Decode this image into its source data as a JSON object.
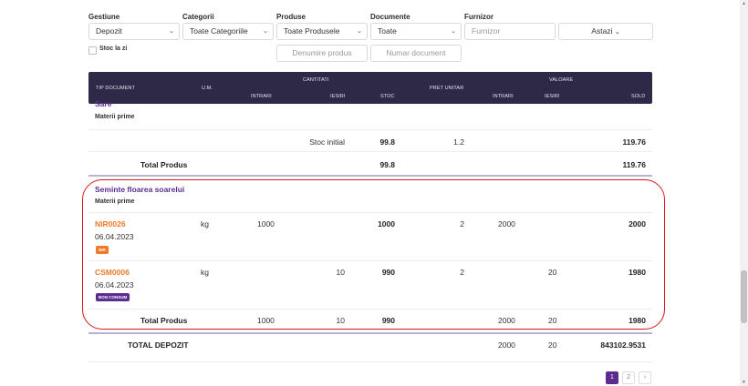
{
  "filters": {
    "gestiune": {
      "label": "Gestiune",
      "value": "Depozit"
    },
    "categorii": {
      "label": "Categorii",
      "value": "Toate Categoriile"
    },
    "produse": {
      "label": "Produse",
      "value": "Toate Produsele",
      "placeholder": "Denumire produs"
    },
    "documente": {
      "label": "Documente",
      "value": "Toate",
      "placeholder": "Numar document"
    },
    "furnizor": {
      "label": "Furnizor",
      "placeholder": "Furnizor"
    },
    "date_button": "Astazi",
    "stoc_la_zi": "Stoc la zi"
  },
  "table_header": {
    "tip_document": "TIP DOCUMENT",
    "um": "U.M.",
    "cantitati": "CANTITATI",
    "intrari": "INTRARI",
    "iesiri": "IESIRI",
    "stoc": "STOC",
    "pret_unitar": "PRET UNITAR",
    "valoare": "VALOARE",
    "v_intrari": "INTRARI",
    "v_iesiri": "IESIRI",
    "sold": "SOLD"
  },
  "product1": {
    "name": "Sare",
    "category": "Materii prime",
    "stoc_initial_label": "Stoc initial",
    "stoc_initial": "99.8",
    "pret": "1.2",
    "sold": "119.76",
    "total_label": "Total Produs",
    "total_stoc": "99.8",
    "total_sold": "119.76"
  },
  "product2": {
    "name": "Seminte floarea soarelui",
    "category": "Materii prime",
    "rows": [
      {
        "doc": "NIR0026",
        "date": "06.04.2023",
        "badge": "NIR",
        "badge_color": "#f0782a",
        "um": "kg",
        "intrari": "1000",
        "iesiri": "",
        "stoc": "1000",
        "pret": "2",
        "v_intrari": "2000",
        "v_iesiri": "",
        "sold": "2000"
      },
      {
        "doc": "CSM0006",
        "date": "06.04.2023",
        "badge": "BON CONSUM",
        "badge_color": "#5b2d91",
        "um": "kg",
        "intrari": "",
        "iesiri": "10",
        "stoc": "990",
        "pret": "2",
        "v_intrari": "",
        "v_iesiri": "20",
        "sold": "1980"
      }
    ],
    "total_label": "Total Produs",
    "total_intrari": "1000",
    "total_iesiri": "10",
    "total_stoc": "990",
    "total_v_intrari": "2000",
    "total_v_iesiri": "20",
    "total_sold": "1980"
  },
  "total_depozit": {
    "label": "TOTAL DEPOZIT",
    "v_intrari": "2000",
    "v_iesiri": "20",
    "sold": "843102.9531"
  },
  "pagination": {
    "pages": [
      "1",
      "2"
    ],
    "current": "1",
    "next": "›"
  },
  "colors": {
    "header_bg": "#2f2948",
    "accent_purple": "#5b2d91",
    "accent_orange": "#f0782a",
    "highlight": "#d8161d"
  }
}
